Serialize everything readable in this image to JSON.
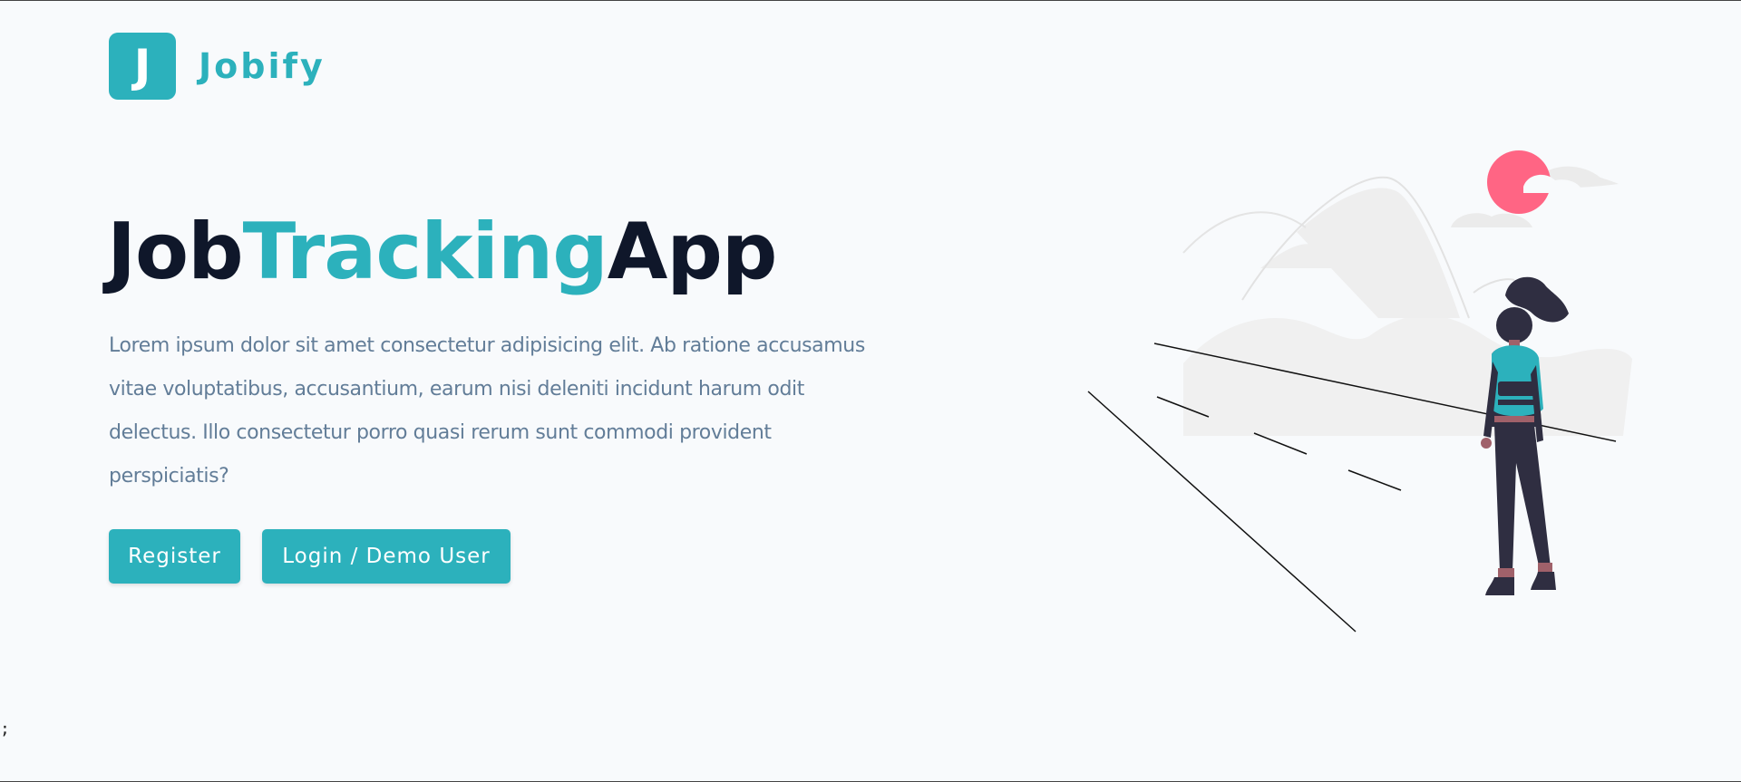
{
  "brand": {
    "logo_letter": "J",
    "name": "Jobify",
    "accent_color": "#2cb1bc",
    "dark_color": "#0f172a",
    "background": "#f8fafc"
  },
  "hero": {
    "title_part1": "Job",
    "title_part2": "Tracking",
    "title_part3": "App",
    "description": "Lorem ipsum dolor sit amet consectetur adipisicing elit. Ab ratione accusamus vitae voluptatibus, accusantium, earum nisi deleniti incidunt harum odit delectus. Illo consectetur porro quasi rerum sunt commodi provident perspiciatis?",
    "register_label": "Register",
    "login_label": "Login / Demo User"
  },
  "footer": {
    "stray_text": ";"
  },
  "illustration": {
    "icon": "woman-with-backpack-on-road-illustration",
    "sun_color": "#ff6584",
    "figure_color": "#2f2e41",
    "backpack_color": "#2cb1bc"
  }
}
